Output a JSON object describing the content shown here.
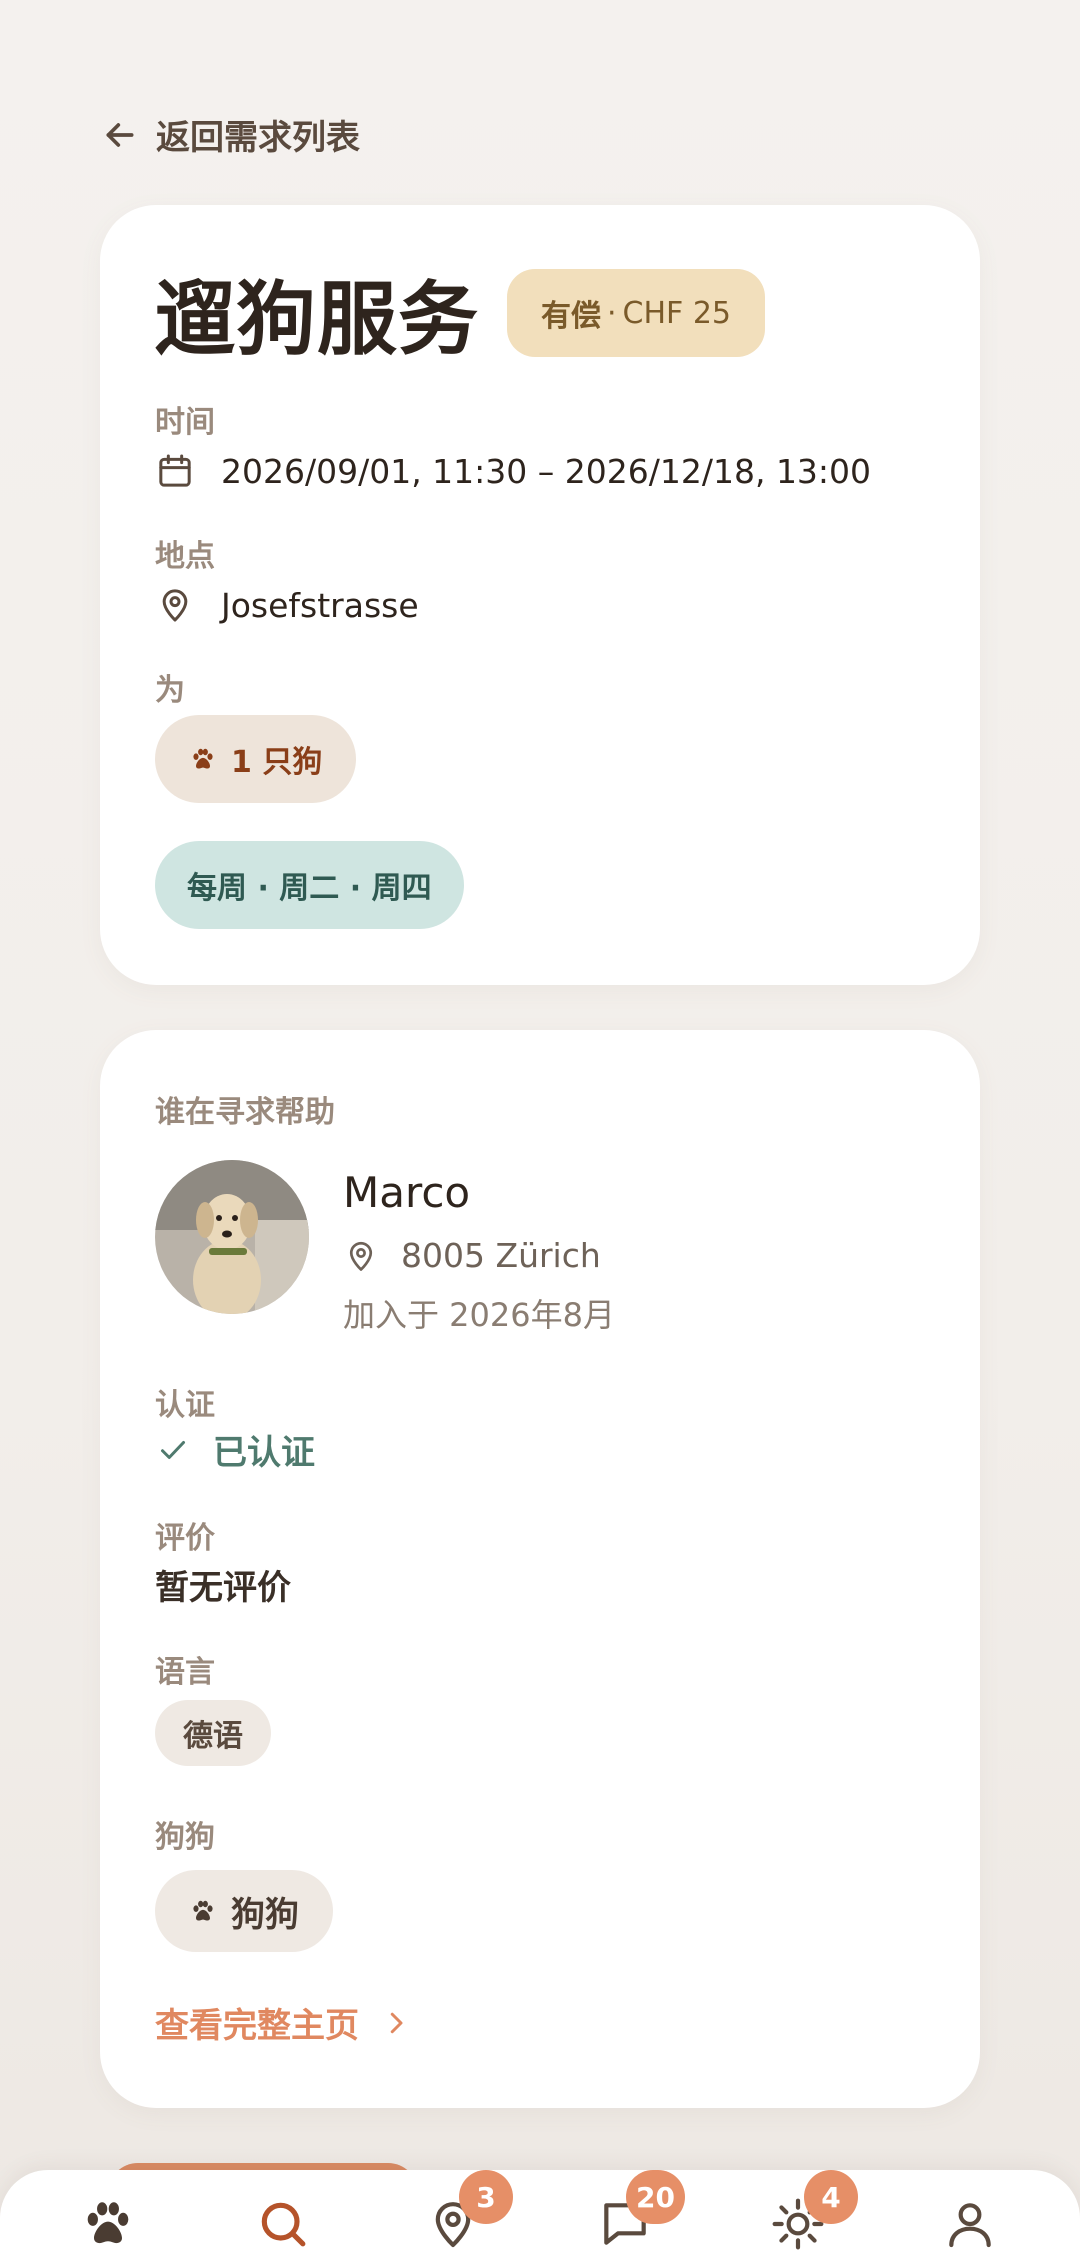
{
  "back_link": {
    "label": "返回需求列表"
  },
  "request": {
    "title": "遛狗服务",
    "price_badge": {
      "type": "有偿",
      "separator": " · ",
      "amount": "CHF 25"
    },
    "time": {
      "label": "时间",
      "value": "2026/09/01, 11:30 – 2026/12/18, 13:00"
    },
    "location": {
      "label": "地点",
      "value": "Josefstrasse"
    },
    "for": {
      "label": "为",
      "dog_count": "1 只狗"
    },
    "frequency": "每周 · 周二 · 周四"
  },
  "requester": {
    "section_label": "谁在寻求帮助",
    "name": "Marco",
    "location": "8005 Zürich",
    "joined": "加入于 2026年8月",
    "verification": {
      "label": "认证",
      "value": "已认证"
    },
    "rating": {
      "label": "评价",
      "value": "暂无评价"
    },
    "languages": {
      "label": "语言",
      "items": [
        "德语"
      ]
    },
    "dogs": {
      "label": "狗狗",
      "items": [
        "狗狗"
      ]
    },
    "profile_link": "查看完整主页"
  },
  "bottom_nav": {
    "items": [
      {
        "icon": "paw-icon",
        "badge": ""
      },
      {
        "icon": "search-icon",
        "badge": ""
      },
      {
        "icon": "map-pin-icon",
        "badge": "3"
      },
      {
        "icon": "chat-icon",
        "badge": "20"
      },
      {
        "icon": "sun-icon",
        "badge": "4"
      },
      {
        "icon": "profile-icon",
        "badge": ""
      }
    ]
  },
  "colors": {
    "accent": "#e08860",
    "price_badge_bg": "#f2dfbc",
    "frequency_bg": "#cfe5e1",
    "verified": "#4f7a6e"
  }
}
